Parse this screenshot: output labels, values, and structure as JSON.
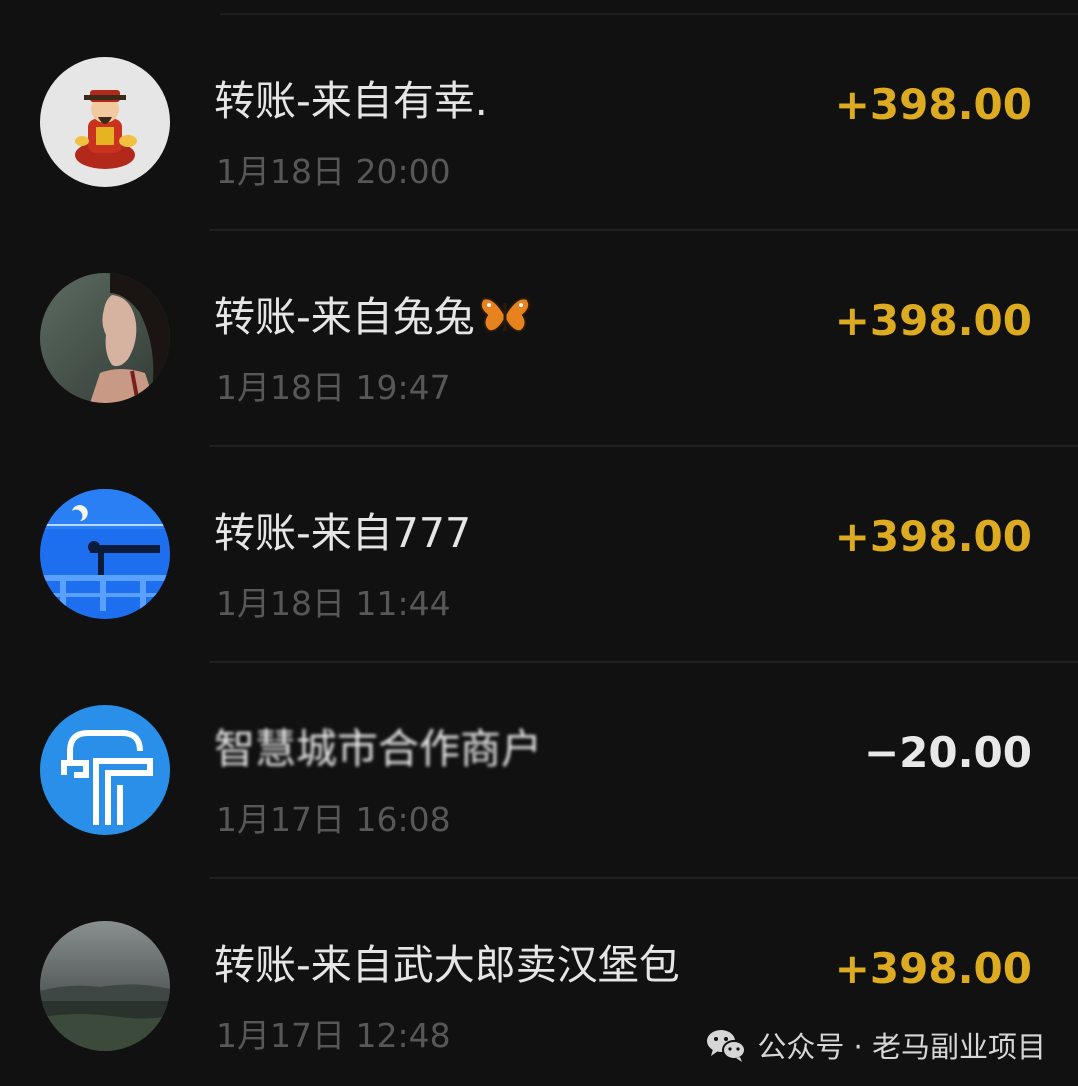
{
  "colors": {
    "background": "#111111",
    "title": "#e5e5e5",
    "time": "#575757",
    "income": "#dcab1f",
    "expense": "#e8e8e8"
  },
  "transactions": [
    {
      "title": "转账-来自有幸.",
      "time": "1月18日 20:00",
      "amount": "+398.00",
      "direction": "income",
      "avatar_icon": "god-of-wealth-avatar-icon"
    },
    {
      "title": "转账-来自兔兔",
      "title_emoji": "butterfly-emoji-icon",
      "time": "1月18日 19:47",
      "amount": "+398.00",
      "direction": "income",
      "avatar_icon": "woman-profile-avatar-icon"
    },
    {
      "title": "转账-来自777",
      "time": "1月18日 11:44",
      "amount": "+398.00",
      "direction": "income",
      "avatar_icon": "blue-night-scene-avatar-icon"
    },
    {
      "title": "智慧城市合作商户",
      "time": "1月17日 16:08",
      "amount": "−20.00",
      "direction": "expense",
      "avatar_icon": "smart-city-logo-avatar-icon"
    },
    {
      "title": "转账-来自武大郎卖汉堡包",
      "time": "1月17日 12:48",
      "amount": "+398.00",
      "direction": "income",
      "avatar_icon": "cloudy-landscape-avatar-icon"
    }
  ],
  "watermark": {
    "text": "公众号 · 老马副业项目",
    "icon": "wechat-icon"
  }
}
